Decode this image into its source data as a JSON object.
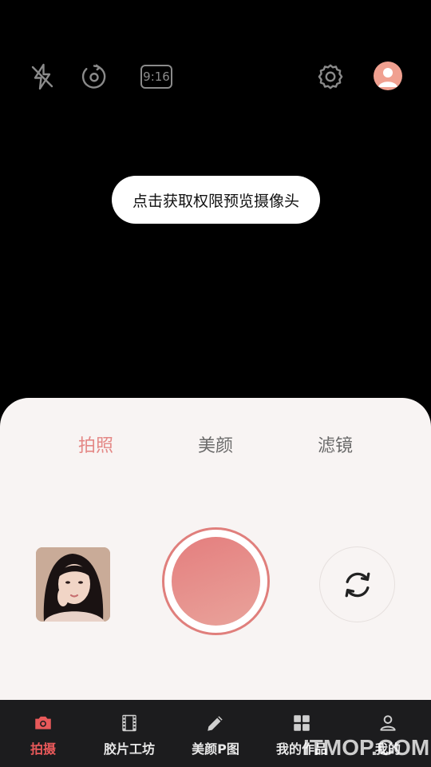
{
  "top_bar": {
    "icons": [
      "flash-off-icon",
      "timer-icon",
      "ratio-icon",
      "settings-icon",
      "avatar"
    ],
    "ratio_label": "9:16"
  },
  "preview": {
    "permission_text": "点击获取权限预览摄像头"
  },
  "panel": {
    "modes": [
      {
        "label": "拍照",
        "active": true
      },
      {
        "label": "美颜",
        "active": false
      },
      {
        "label": "滤镜",
        "active": false
      }
    ],
    "accent_color": "#e48886"
  },
  "bottom_nav": {
    "items": [
      {
        "label": "拍摄",
        "icon": "camera-icon",
        "active": true
      },
      {
        "label": "胶片工坊",
        "icon": "film-icon",
        "active": false
      },
      {
        "label": "美颜P图",
        "icon": "pencil-icon",
        "active": false
      },
      {
        "label": "我的作品",
        "icon": "grid-icon",
        "active": false
      },
      {
        "label": "我的",
        "icon": "person-icon",
        "active": false
      }
    ],
    "active_color": "#e8595a"
  },
  "watermark": "ITMOP.COM"
}
